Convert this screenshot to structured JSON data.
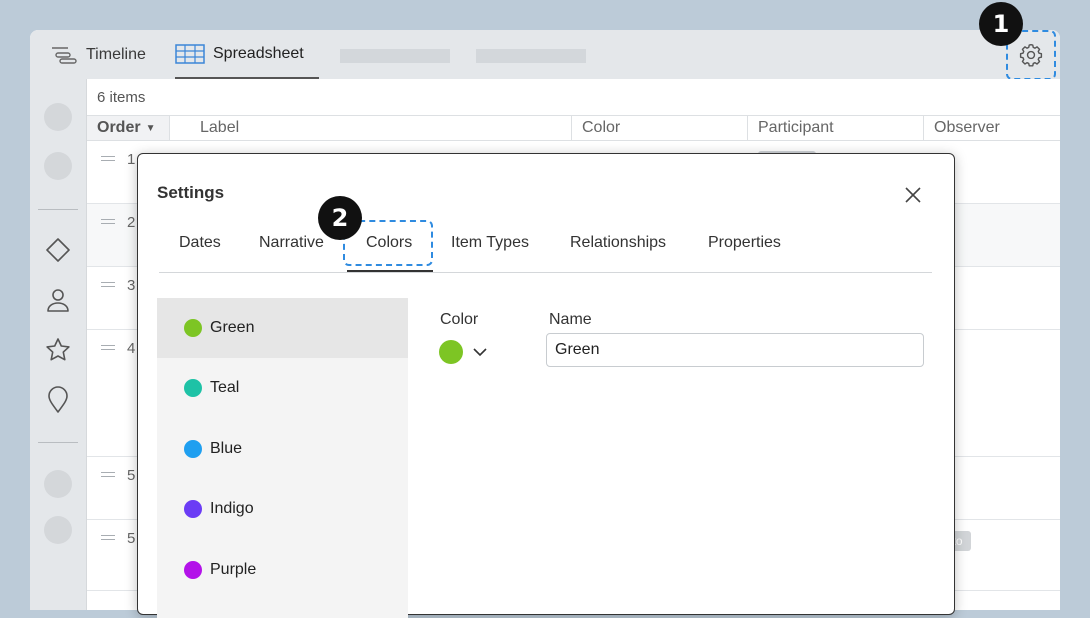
{
  "tabs": [
    {
      "label": "Timeline",
      "icon": "timeline-icon"
    },
    {
      "label": "Spreadsheet",
      "icon": "spreadsheet-icon"
    }
  ],
  "badges": [
    "1",
    "2"
  ],
  "grid": {
    "item_count": "6 items",
    "columns": [
      "Order",
      "Label",
      "Color",
      "Participant",
      "Observer"
    ],
    "row_numbers": [
      "1",
      "2",
      "3",
      "4",
      "5",
      "5"
    ],
    "partial_tag": "to"
  },
  "dialog": {
    "title": "Settings",
    "tabs": [
      "Dates",
      "Narrative",
      "Colors",
      "Item Types",
      "Relationships",
      "Properties"
    ],
    "active_tab": "Colors",
    "colors": [
      {
        "name": "Green",
        "hex": "#7dc524"
      },
      {
        "name": "Teal",
        "hex": "#1ec2a6"
      },
      {
        "name": "Blue",
        "hex": "#1f9ff0"
      },
      {
        "name": "Indigo",
        "hex": "#6b3cf5"
      },
      {
        "name": "Purple",
        "hex": "#b312e9"
      }
    ],
    "selected_color": "Green",
    "field_color_label": "Color",
    "field_name_label": "Name",
    "name_value": "Green"
  },
  "accent": "#2f8be0"
}
